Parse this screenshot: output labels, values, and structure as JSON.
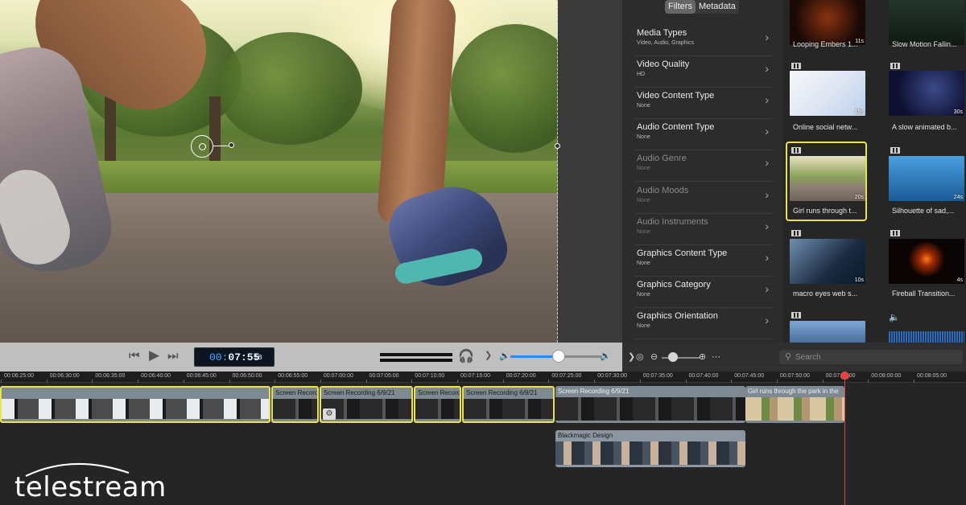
{
  "transport": {
    "rewind_icon": "skip-back-icon",
    "play_icon": "play-icon",
    "forward_icon": "skip-forward-icon",
    "timecode_prefix": "00:",
    "timecode_main": "07:55",
    "timecode_frames": "18",
    "headphones_icon": "headphones-icon",
    "volume_level": 0.52
  },
  "browser": {
    "tabs": [
      {
        "label": "Filters",
        "active": true
      },
      {
        "label": "Metadata",
        "active": false
      }
    ],
    "search_placeholder": "Search",
    "filters": [
      {
        "title": "Media Types",
        "value": "Video, Audio, Graphics",
        "enabled": true
      },
      {
        "title": "Video Quality",
        "value": "HD",
        "enabled": true
      },
      {
        "title": "Video Content Type",
        "value": "None",
        "enabled": true
      },
      {
        "title": "Audio Content Type",
        "value": "None",
        "enabled": true
      },
      {
        "title": "Audio Genre",
        "value": "None",
        "enabled": false
      },
      {
        "title": "Audio Moods",
        "value": "None",
        "enabled": false
      },
      {
        "title": "Audio Instruments",
        "value": "None",
        "enabled": false
      },
      {
        "title": "Graphics Content Type",
        "value": "None",
        "enabled": true
      },
      {
        "title": "Graphics Category",
        "value": "None",
        "enabled": true
      },
      {
        "title": "Graphics Orientation",
        "value": "None",
        "enabled": true
      }
    ],
    "media": [
      {
        "name": "Looping Embers 1...",
        "duration": "11s"
      },
      {
        "name": "Slow Motion Fallin...",
        "duration": ""
      },
      {
        "name": "Online social netw...",
        "duration": "15s"
      },
      {
        "name": "A slow animated b...",
        "duration": "30s"
      },
      {
        "name": "Girl runs through t...",
        "duration": "20s",
        "selected": true
      },
      {
        "name": "Silhouette of sad,...",
        "duration": "24s"
      },
      {
        "name": "macro eyes web s...",
        "duration": "10s"
      },
      {
        "name": "Fireball Transition...",
        "duration": "4s"
      },
      {
        "name": "",
        "duration": ""
      },
      {
        "name": "",
        "duration": ""
      }
    ]
  },
  "timeline": {
    "ruler": [
      "00:06:25:00",
      "00:06:30:00",
      "00:06:35:00",
      "00:06:40:00",
      "00:06:45:00",
      "00:06:50:00",
      "00:06:55:00",
      "00:07:00:00",
      "00:07:05:00",
      "00:07:10:00",
      "00:07:15:00",
      "00:07:20:00",
      "00:07:25:00",
      "00:07:30:00",
      "00:07:35:00",
      "00:07:40:00",
      "00:07:45:00",
      "00:07:50:00",
      "00:07:55:00",
      "00:08:00:00",
      "00:08:05:00"
    ],
    "clips": [
      {
        "title": "",
        "track": 1,
        "selected": true
      },
      {
        "title": "Screen Record",
        "track": 1,
        "selected": true
      },
      {
        "title": "Screen Recording 6/9/21",
        "track": 1,
        "selected": true
      },
      {
        "title": "Screen Record",
        "track": 1,
        "selected": true
      },
      {
        "title": "Screen Recording 6/9/21",
        "track": 1,
        "selected": true
      },
      {
        "title": "Screen Recording 6/9/21",
        "track": 1,
        "selected": false
      },
      {
        "title": "Girl runs through the park in the",
        "track": 1,
        "selected": false
      },
      {
        "title": "Blackmagic Design",
        "track": 2,
        "selected": false
      }
    ]
  },
  "logo": {
    "text": "telestream"
  },
  "colors": {
    "selection": "#e9e24b",
    "playhead": "#e24444",
    "accent": "#2b86ff",
    "timecode": "#4aa8ff"
  }
}
